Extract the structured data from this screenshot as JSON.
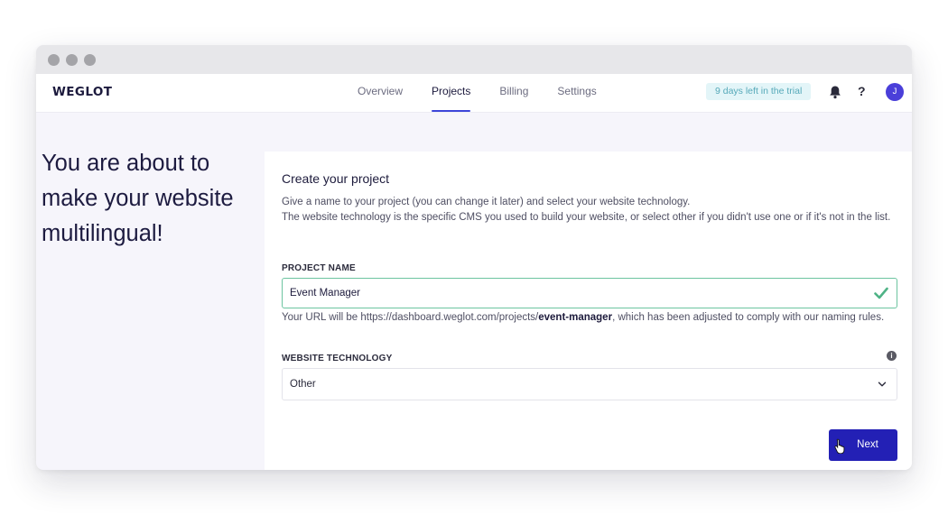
{
  "logo": "WEGLOT",
  "nav": {
    "tabs": [
      {
        "label": "Overview",
        "active": false
      },
      {
        "label": "Projects",
        "active": true
      },
      {
        "label": "Billing",
        "active": false
      },
      {
        "label": "Settings",
        "active": false
      }
    ]
  },
  "header": {
    "trial_badge": "9 days left in the trial",
    "help_label": "?",
    "avatar_initial": "J"
  },
  "headline": "You are about to make your website multilingual!",
  "form": {
    "title": "Create your project",
    "description_line1": "Give a name to your project (you can change it later) and select your website technology.",
    "description_line2": "The website technology is the specific CMS you used to build your website, or select other if you didn't use one or if it's not in the list.",
    "project_name_label": "PROJECT NAME",
    "project_name_value": "Event Manager",
    "url_note_prefix": "Your URL will be https://dashboard.weglot.com/projects/",
    "url_slug": "event-manager",
    "url_note_suffix": ", which has been adjusted to comply with our naming rules.",
    "website_technology_label": "WEBSITE TECHNOLOGY",
    "info_glyph": "i",
    "website_technology_value": "Other",
    "next_label": "Next"
  },
  "colors": {
    "accent": "#3d46d9",
    "button": "#2320b5",
    "success": "#4fb386",
    "trial_bg": "#e3f5f8",
    "trial_text": "#56a9b9"
  },
  "icons": [
    "bell-icon",
    "help-icon",
    "check-icon",
    "info-icon",
    "chevron-down-icon",
    "pointer-cursor-icon"
  ]
}
